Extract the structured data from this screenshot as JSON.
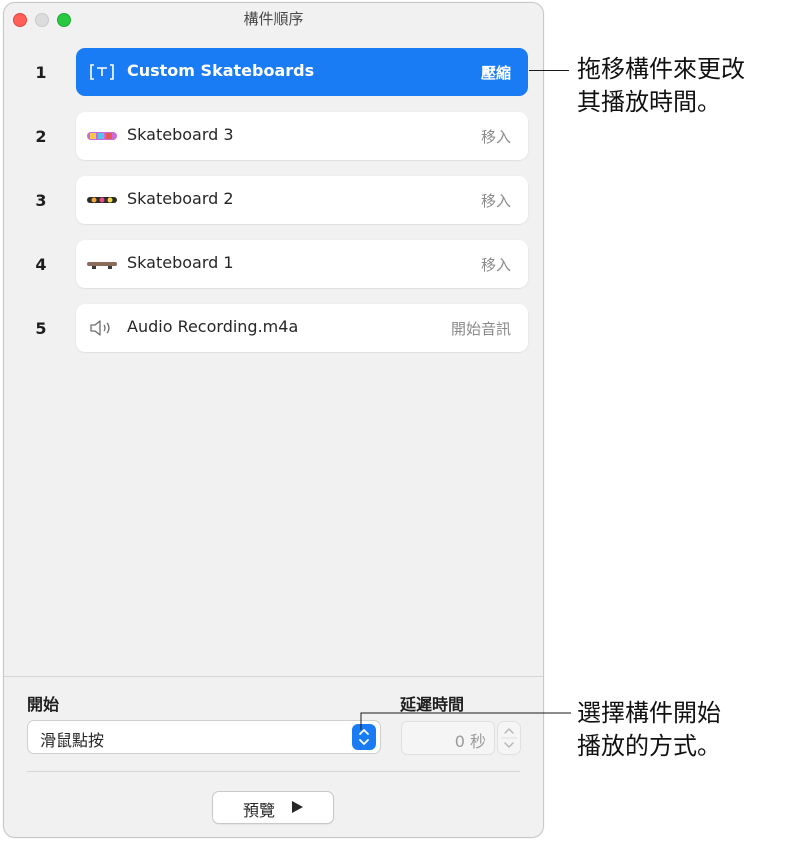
{
  "window": {
    "title": "構件順序"
  },
  "rows": [
    {
      "number": "1",
      "label": "Custom Skateboards",
      "action": "壓縮",
      "icon": "text-box-icon",
      "selected": true
    },
    {
      "number": "2",
      "label": "Skateboard 3",
      "action": "移入",
      "icon": "skateboard-3-thumbnail",
      "selected": false
    },
    {
      "number": "3",
      "label": "Skateboard 2",
      "action": "移入",
      "icon": "skateboard-2-thumbnail",
      "selected": false
    },
    {
      "number": "4",
      "label": "Skateboard 1",
      "action": "移入",
      "icon": "skateboard-1-thumbnail",
      "selected": false
    },
    {
      "number": "5",
      "label": "Audio Recording.m4a",
      "action": "開始音訊",
      "icon": "speaker-icon",
      "selected": false
    }
  ],
  "bottom": {
    "start_label": "開始",
    "start_value": "滑鼠點按",
    "delay_label": "延遲時間",
    "delay_value": "0 秒",
    "preview_label": "預覽"
  },
  "callouts": {
    "top": "拖移構件來更改\n其播放時間。",
    "bottom": "選擇構件開始\n播放的方式。"
  },
  "colors": {
    "accent": "#1a7cf5",
    "close": "#ff5f57",
    "minimize": "#dcdcdc",
    "maximize": "#28c840"
  }
}
